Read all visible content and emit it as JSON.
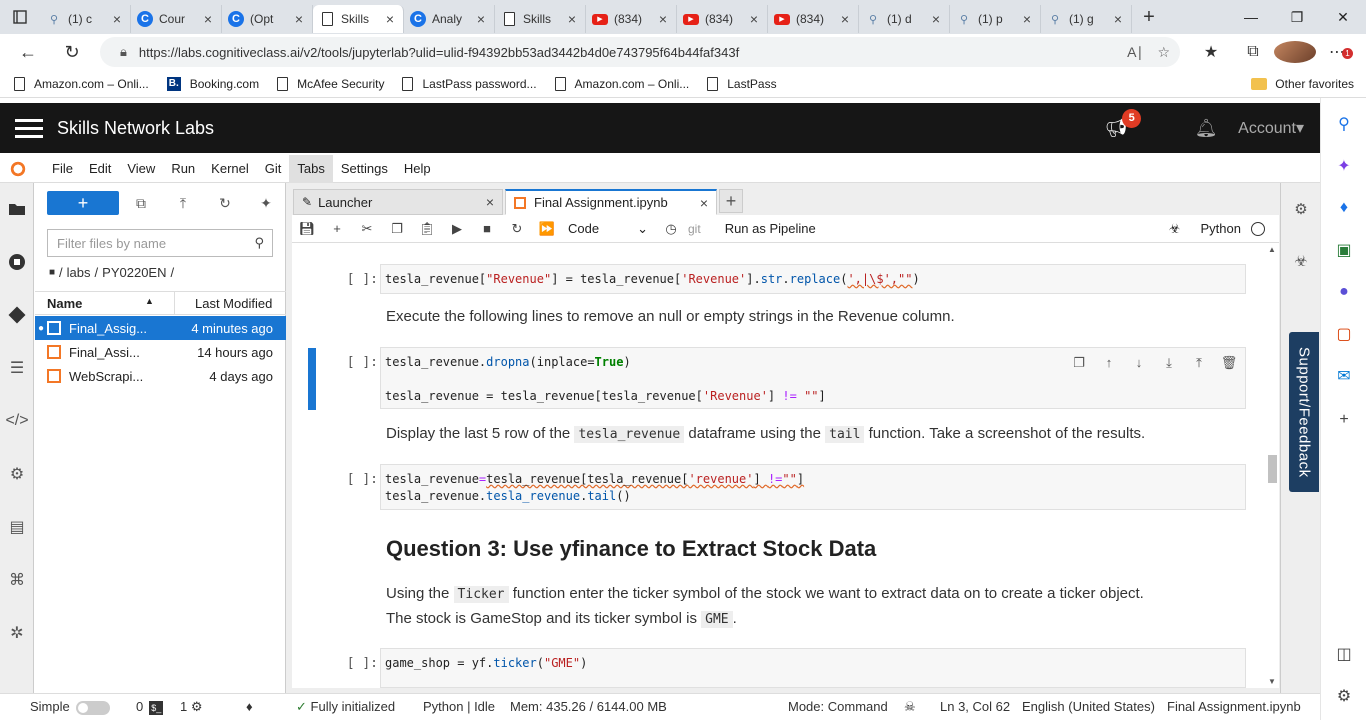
{
  "browser": {
    "tabs": [
      {
        "icon": "search-icon",
        "label": "(1) c"
      },
      {
        "icon": "coursera-icon",
        "label": "Cour"
      },
      {
        "icon": "coursera-icon",
        "label": "(Opt"
      },
      {
        "icon": "document-icon",
        "label": "Skills",
        "active": true
      },
      {
        "icon": "coursera-icon",
        "label": "Analy"
      },
      {
        "icon": "document-icon",
        "label": "Skills"
      },
      {
        "icon": "youtube-icon",
        "label": "(834)"
      },
      {
        "icon": "youtube-icon",
        "label": "(834)"
      },
      {
        "icon": "youtube-icon",
        "label": "(834)"
      },
      {
        "icon": "search-icon",
        "label": "(1) d"
      },
      {
        "icon": "search-icon",
        "label": "(1) p"
      },
      {
        "icon": "search-icon",
        "label": "(1) g"
      }
    ],
    "url": "https://labs.cognitiveclass.ai/v2/tools/jupyterlab?ulid=ulid-f94392bb53ad3442b4d0e743795f64b44faf343f",
    "bookmarks": [
      {
        "label": "Amazon.com – Onli...",
        "icon": "document-icon"
      },
      {
        "label": "Booking.com",
        "icon": "booking-icon"
      },
      {
        "label": "McAfee Security",
        "icon": "document-icon"
      },
      {
        "label": "LastPass password...",
        "icon": "document-icon"
      },
      {
        "label": "Amazon.com – Onli...",
        "icon": "document-icon"
      },
      {
        "label": "LastPass",
        "icon": "document-icon"
      }
    ],
    "other_favorites": "Other favorites",
    "notification_count": "1"
  },
  "header": {
    "title": "Skills Network Labs",
    "announcement_count": "5",
    "account": "Account"
  },
  "menu": [
    "File",
    "Edit",
    "View",
    "Run",
    "Kernel",
    "Git",
    "Tabs",
    "Settings",
    "Help"
  ],
  "filebrowser": {
    "new_label": "+",
    "filter_placeholder": "Filter files by name",
    "path": [
      "labs",
      "PY0220EN"
    ],
    "col_name": "Name",
    "col_modified": "Last Modified",
    "files": [
      {
        "name": "Final_Assig...",
        "modified": "4 minutes ago",
        "selected": true
      },
      {
        "name": "Final_Assi...",
        "modified": "14 hours ago"
      },
      {
        "name": "WebScrapi...",
        "modified": "4 days ago"
      }
    ]
  },
  "tabs": [
    {
      "label": "Launcher"
    },
    {
      "label": "Final Assignment.ipynb",
      "active": true
    }
  ],
  "toolbar": {
    "cell_type": "Code",
    "git": "git",
    "run_pipeline": "Run as Pipeline",
    "kernel": "Python"
  },
  "cells": {
    "c1_prompt": "[ ]:",
    "c1_md": "Execute the following lines to remove an null or empty strings in the Revenue column.",
    "c2_prompt": "[ ]:",
    "c3_md_a": "Display the last 5 row of the",
    "c3_md_code1": "tesla_revenue",
    "c3_md_b": "dataframe using the",
    "c3_md_code2": "tail",
    "c3_md_c": "function. Take a screenshot of the results.",
    "c4_prompt": "[ ]:",
    "q3_heading": "Question 3: Use yfinance to Extract Stock Data",
    "q3_md_a": "Using the",
    "q3_md_code1": "Ticker",
    "q3_md_b": "function enter the ticker symbol of the stock we want to extract data on to create a ticker object.",
    "q3_md_c": "The stock is GameStop and its ticker symbol is",
    "q3_md_code2": "GME",
    "q3_md_d": ".",
    "c5_prompt": "[ ]:"
  },
  "support": "Support/Feedback",
  "status": {
    "mode": "Simple",
    "terminals": "0",
    "kernels": "1",
    "initialized": "Fully initialized",
    "kernel_state": "Python | Idle",
    "memory": "Mem: 435.26 / 6144.00 MB",
    "command_mode": "Mode: Command",
    "cursor": "Ln 3, Col 62",
    "language": "English (United States)",
    "filename": "Final Assignment.ipynb"
  }
}
